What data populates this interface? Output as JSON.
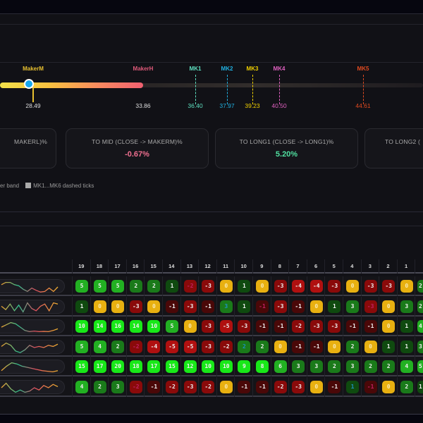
{
  "gauge": {
    "current_value": "28.49",
    "labels": [
      {
        "name": "MakerM",
        "value": "",
        "color": "#e8c030"
      },
      {
        "name": "MakerH",
        "value": "33.86",
        "color": "#e05a7a"
      }
    ],
    "markers": [
      {
        "name": "MK1",
        "value": "36.40",
        "color": "#5ee0c0"
      },
      {
        "name": "MK2",
        "value": "37.97",
        "color": "#20b0e0"
      },
      {
        "name": "MK3",
        "value": "39.23",
        "color": "#f0d000"
      },
      {
        "name": "MK4",
        "value": "40.50",
        "color": "#e060c0"
      },
      {
        "name": "MK5",
        "value": "44.61",
        "color": "#e04a20"
      }
    ]
  },
  "cards": [
    {
      "title": "MAKERL)%",
      "value": ""
    },
    {
      "title": "TO MID (CLOSE -> MAKERM)%",
      "value": "-0.67%",
      "color": "#f07090"
    },
    {
      "title": "TO LONG1 (CLOSE -> LONG1)%",
      "value": "5.20%",
      "color": "#50e0a0"
    },
    {
      "title": "TO LONG2 (",
      "value": ""
    }
  ],
  "legend": {
    "item1": "er band",
    "item2": "MK1...MK6 dashed ticks"
  },
  "table": {
    "columns": [
      "19",
      "18",
      "17",
      "16",
      "15",
      "14",
      "13",
      "12",
      "11",
      "10",
      "9",
      "8",
      "7",
      "6",
      "5",
      "4",
      "3",
      "2",
      "1",
      ""
    ],
    "rows": [
      {
        "cells": [
          5,
          5,
          5,
          2,
          2,
          1,
          -2,
          -3,
          0,
          1,
          0,
          -3,
          -4,
          -4,
          -3,
          0,
          -3,
          -3,
          0,
          2
        ],
        "muted": [
          6
        ],
        "spark": [
          0.7,
          0.9,
          0.9,
          0.7,
          0.6,
          0.3,
          0.1,
          0.4,
          0.2,
          0.05,
          0.1,
          0.4,
          0.1,
          0.5
        ]
      },
      {
        "cells": [
          1,
          0,
          0,
          -3,
          0,
          -1,
          -3,
          -1,
          3,
          1,
          -1,
          -3,
          -1,
          0,
          1,
          3,
          -3,
          0,
          3,
          2
        ],
        "muted": [
          8,
          10,
          16
        ],
        "spark": [
          0.6,
          0.3,
          0.8,
          0.2,
          0.7,
          0.1,
          0.9,
          0.4,
          0.2,
          0.6,
          0.8,
          0.2,
          0.9,
          0.8
        ]
      },
      {
        "cells": [
          10,
          14,
          16,
          14,
          10,
          5,
          0,
          -3,
          -5,
          -3,
          -1,
          -1,
          -2,
          -3,
          -3,
          -1,
          -1,
          0,
          1,
          4
        ],
        "muted": [],
        "spark": [
          0.5,
          0.7,
          0.9,
          0.8,
          0.5,
          0.2,
          0.1,
          0.15,
          0.1,
          0.12,
          0.1,
          0.2,
          0.35
        ]
      },
      {
        "cells": [
          5,
          4,
          2,
          -2,
          -4,
          -5,
          -5,
          -3,
          -2,
          2,
          2,
          0,
          -1,
          -1,
          0,
          2,
          0,
          1,
          1,
          3
        ],
        "muted": [
          3,
          9
        ],
        "spark": [
          0.6,
          0.9,
          0.7,
          0.2,
          0.05,
          0.3,
          0.7,
          0.5,
          0.6,
          0.5,
          0.7,
          0.6,
          0.8
        ]
      },
      {
        "cells": [
          15,
          17,
          20,
          18,
          17,
          15,
          12,
          10,
          10,
          9,
          8,
          6,
          3,
          3,
          2,
          3,
          2,
          2,
          4,
          5
        ],
        "muted": [],
        "spark": [
          0.2,
          0.6,
          0.9,
          0.8,
          0.6,
          0.5,
          0.4,
          0.3,
          0.2,
          0.15,
          0.1,
          0.2
        ]
      },
      {
        "cells": [
          4,
          2,
          3,
          -2,
          -1,
          -2,
          -3,
          -2,
          0,
          -1,
          -1,
          -2,
          -3,
          0,
          -1,
          1,
          -1,
          0,
          2,
          1
        ],
        "muted": [
          3,
          15,
          16
        ],
        "spark": [
          0.5,
          0.9,
          0.4,
          0.1,
          0.3,
          0.1,
          0.2,
          0.5,
          0.3,
          0.7,
          0.5,
          0.8,
          0.6
        ]
      }
    ]
  },
  "colors": {
    "zero": "#e8b010",
    "muted_text": "#c02060",
    "muted_pos_text": "#2090c0"
  }
}
